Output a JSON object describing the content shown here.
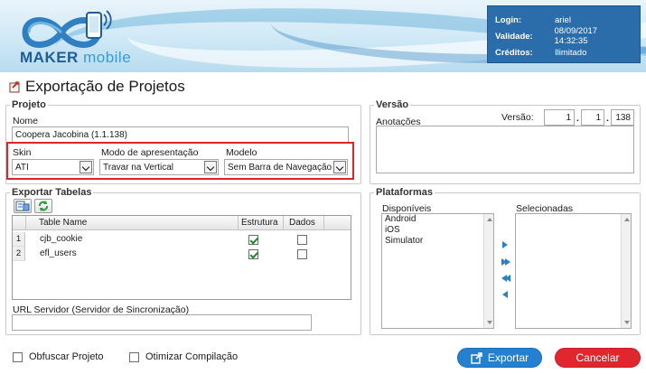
{
  "header": {
    "logo": {
      "word1": "MAKER",
      "word2": "mobile"
    },
    "login": {
      "rows": [
        {
          "key": "Login:",
          "value": "ariel"
        },
        {
          "key": "Validade:",
          "value": "08/09/2017 14:32:35"
        },
        {
          "key": "Créditos:",
          "value": "Ilimitado"
        }
      ]
    }
  },
  "page": {
    "title": "Exportação de Projetos"
  },
  "projeto": {
    "legend": "Projeto",
    "nome_label": "Nome",
    "nome_value": "Coopera Jacobina (1.1.138)",
    "skin_label": "Skin",
    "skin_value": "ATI",
    "modo_label": "Modo de apresentação",
    "modo_value": "Travar na Vertical",
    "modelo_label": "Modelo",
    "modelo_value": "Sem Barra de Navegação"
  },
  "versao": {
    "legend": "Versão",
    "anotacoes_label": "Anotações",
    "versao_label": "Versão:",
    "major": "1",
    "minor": "1",
    "build": "138"
  },
  "exportar": {
    "legend": "Exportar Tabelas",
    "columns": [
      "Table Name",
      "Estrutura",
      "Dados"
    ],
    "rows": [
      {
        "num": "1",
        "name": "cjb_cookie",
        "estrutura": true,
        "dados": false
      },
      {
        "num": "2",
        "name": "efl_users",
        "estrutura": true,
        "dados": false
      }
    ],
    "url_label": "URL Servidor (Servidor de Sincronização)",
    "url_value": ""
  },
  "plataformas": {
    "legend": "Plataformas",
    "disponiveis_label": "Disponíveis",
    "disponiveis": [
      "Android",
      "iOS",
      "Simulator"
    ],
    "selecionadas_label": "Selecionadas",
    "selecionadas": []
  },
  "options": {
    "obfuscar_label": "Obfuscar Projeto",
    "otimizar_label": "Otimizar Compilação"
  },
  "actions": {
    "export_label": "Exportar",
    "cancel_label": "Cancelar"
  },
  "colors": {
    "accent": "#2581cf",
    "danger": "#e0262f",
    "login_bg": "#2b6cab",
    "highlight": "#d8262c"
  }
}
